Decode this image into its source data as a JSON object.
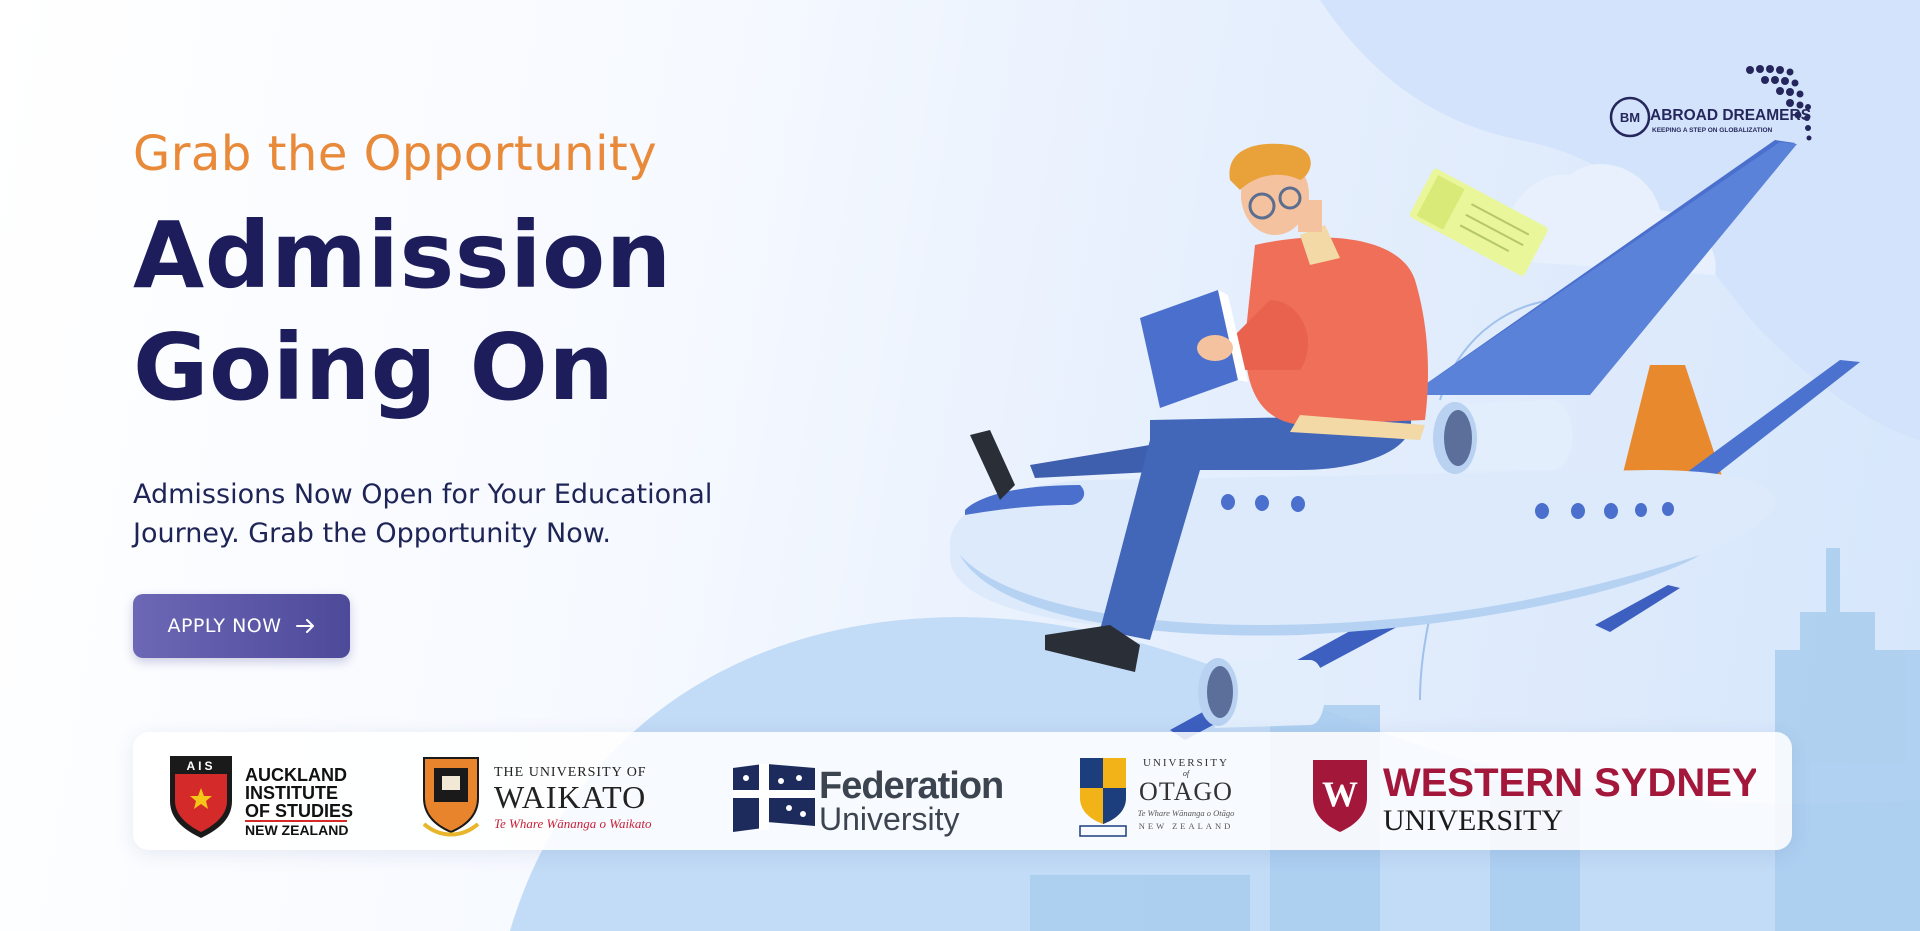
{
  "hero": {
    "eyebrow": "Grab the Opportunity",
    "headline_line1": "Admission",
    "headline_line2": "Going On",
    "subtext_line1": "Admissions Now Open for Your Educational",
    "subtext_line2": "Journey. Grab the Opportunity Now.",
    "cta_label": "APPLY NOW"
  },
  "brand": {
    "initials": "BM",
    "name": "ABROAD DREAMERS",
    "tagline": "KEEPING A STEP ON GLOBALIZATION"
  },
  "partners": {
    "ais": {
      "badge": "AIS",
      "line1": "AUCKLAND",
      "line2": "INSTITUTE",
      "line3": "OF STUDIES",
      "line4": "NEW ZEALAND"
    },
    "waikato": {
      "line1": "THE UNIVERSITY OF",
      "line2": "WAIKATO",
      "line3": "Te Whare Wānanga o Waikato"
    },
    "federation": {
      "line1": "Federation",
      "line2": "University"
    },
    "otago": {
      "line1": "UNIVERSITY",
      "line2": "of",
      "line3": "OTAGO",
      "line4": "Te Whare Wānanga o Otāgo",
      "line5": "NEW ZEALAND"
    },
    "wsu": {
      "mark": "W",
      "line1": "WESTERN SYDNEY",
      "line2": "UNIVERSITY"
    }
  },
  "colors": {
    "accent_orange": "#e88a3a",
    "headline_navy": "#1d1d5c",
    "button_purple": "#5e5aa8",
    "plane_blue": "#4a72cc",
    "wsu_red": "#a3173b"
  },
  "icons": [
    "arrow-right-icon",
    "airplane-illustration",
    "student-illustration",
    "ticket-icon",
    "book-icon"
  ]
}
